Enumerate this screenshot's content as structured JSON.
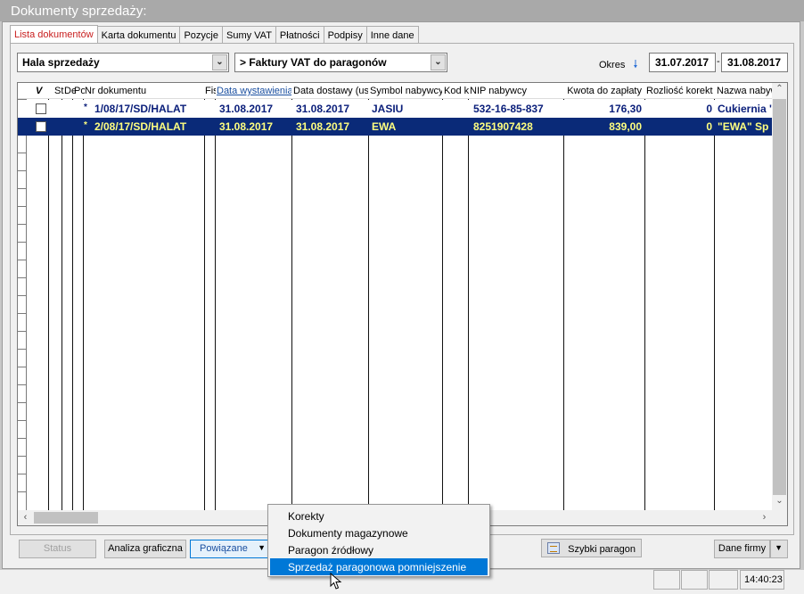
{
  "window": {
    "title": "Dokumenty sprzedaży:"
  },
  "tabs": [
    "Lista dokumentów",
    "Karta dokumentu",
    "Pozycje",
    "Sumy VAT",
    "Płatności",
    "Podpisy",
    "Inne dane"
  ],
  "filters": {
    "location": "Hala sprzedaży",
    "doc_type": "> Faktury VAT do paragonów",
    "period_label": "Okres",
    "date_from": "31.07.2017",
    "date_separator": "-",
    "date_to": "31.08.2017"
  },
  "grid": {
    "headers": {
      "check": "V",
      "status": "St",
      "de": "De",
      "po": "Po",
      "number": "Nr dokumentu",
      "fis": "Fis",
      "issue_date": "Data wystawienia",
      "delivery_date": "Data dostawy (usł",
      "buyer_symbol": "Symbol nabywcy",
      "code": "Kod ki",
      "nip": "NIP nabywcy",
      "amount": "Kwota do zapłaty",
      "settlement": "Rozliość korekt",
      "buyer_name": "Nazwa nabyw"
    },
    "rows": [
      {
        "marker": "*",
        "number": "1/08/17/SD/HALAT",
        "issue_date": "31.08.2017",
        "delivery_date": "31.08.2017",
        "buyer_symbol": "JASIU",
        "nip": "532-16-85-837",
        "amount": "176,30",
        "settlement": "0",
        "buyer_name": "Cukiernia '"
      },
      {
        "marker": "*",
        "number": "2/08/17/SD/HALAT",
        "issue_date": "31.08.2017",
        "delivery_date": "31.08.2017",
        "buyer_symbol": "EWA",
        "nip": "8251907428",
        "amount": "839,00",
        "settlement": "0",
        "buyer_name": "\"EWA\" Sp"
      }
    ]
  },
  "buttons": {
    "status": "Status",
    "chart_analysis": "Analiza graficzna",
    "related": "Powiązane",
    "quick_receipt": "Szybki paragon",
    "company_data": "Dane firmy"
  },
  "context_menu": {
    "items": [
      "Korekty",
      "Dokumenty magazynowe",
      "Paragon źródłowy",
      "Sprzedaż paragonowa pomniejszenie"
    ],
    "highlighted_index": 3
  },
  "statusbar": {
    "time": "14:40:23"
  },
  "colors": {
    "selected_row_bg": "#0a2a78",
    "selected_row_fg": "#ffff80",
    "row_fg": "#0a1e7a",
    "menu_highlight": "#0078d7"
  }
}
